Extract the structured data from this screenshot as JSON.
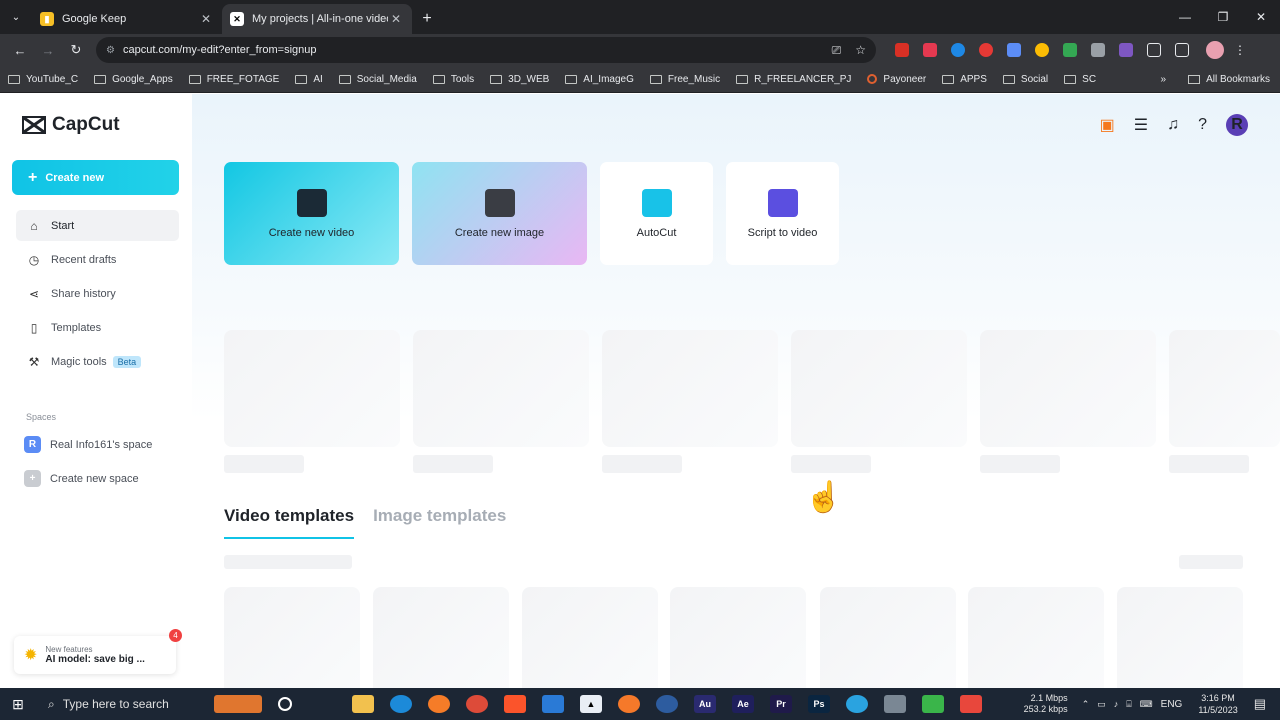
{
  "browser": {
    "tabs": [
      {
        "title": "Google Keep",
        "favicon_color": "#f6bf26"
      },
      {
        "title": "My projects | All-in-one video",
        "favicon_color": "#ffffff"
      }
    ],
    "url": "capcut.com/my-edit?enter_from=signup",
    "bookmarks": [
      "YouTube_C",
      "Google_Apps",
      "FREE_FOTAGE",
      "AI",
      "Social_Media",
      "Tools",
      "3D_WEB",
      "AI_ImageG",
      "Free_Music",
      "R_FREELANCER_PJ",
      "Payoneer",
      "APPS",
      "Social",
      "SC"
    ],
    "all_bookmarks": "All Bookmarks"
  },
  "app": {
    "logo": "CapCut",
    "create_new": "Create new",
    "nav": [
      {
        "label": "Start",
        "icon": "home-icon"
      },
      {
        "label": "Recent drafts",
        "icon": "clock-icon"
      },
      {
        "label": "Share history",
        "icon": "share-icon"
      },
      {
        "label": "Templates",
        "icon": "templates-icon"
      },
      {
        "label": "Magic tools",
        "icon": "magic-wand-icon",
        "badge": "Beta"
      }
    ],
    "spaces_label": "Spaces",
    "space_name": "Real Info161's space",
    "space_initial": "R",
    "create_space": "Create new space",
    "new_features_label": "New features",
    "new_features_text": "AI model: save big ...",
    "notification_count": "4",
    "avatar_initial": "R",
    "quick_cards": [
      {
        "label": "Create new video"
      },
      {
        "label": "Create new image"
      },
      {
        "label": "AutoCut"
      },
      {
        "label": "Script to video"
      }
    ],
    "template_tabs": [
      "Video templates",
      "Image templates"
    ],
    "accent": "#10c3e6"
  },
  "taskbar": {
    "search_placeholder": "Type here to search",
    "net_down": "2.1 Mbps",
    "net_up": "253.2 kbps",
    "lang": "ENG",
    "time": "3:16 PM",
    "date": "11/5/2023"
  }
}
